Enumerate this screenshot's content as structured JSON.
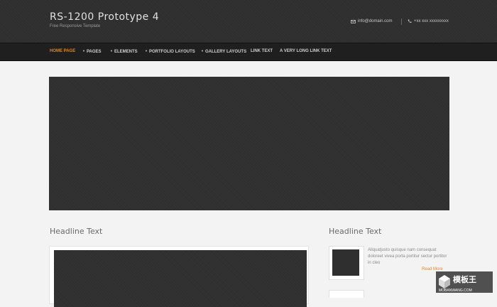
{
  "header": {
    "title": "RS-1200 Prototype 4",
    "tagline": "Free Responsive Template",
    "email": "info@domain.com",
    "phone": "+xx xxx xxxxxxxxx"
  },
  "nav": {
    "items": [
      {
        "label": "HOME PAGE",
        "active": true,
        "has_dropdown": false
      },
      {
        "label": "PAGES",
        "active": false,
        "has_dropdown": true
      },
      {
        "label": "ELEMENTS",
        "active": false,
        "has_dropdown": true
      },
      {
        "label": "PORTFOLIO LAYOUTS",
        "active": false,
        "has_dropdown": true
      },
      {
        "label": "GALLERY LAYOUTS",
        "active": false,
        "has_dropdown": true
      },
      {
        "label": "LINK TEXT",
        "active": false,
        "has_dropdown": false
      },
      {
        "label": "A VERY LONG LINK TEXT",
        "active": false,
        "has_dropdown": false
      }
    ]
  },
  "content": {
    "left_headline": "Headline Text",
    "right_headline": "Headline Text",
    "side_text": "Aliquatjusto quisque nam consequat doloreet vivea porta portitur sectur portitor in cleo",
    "read_more": "Read More"
  },
  "watermark": {
    "brand": "模板王",
    "url": "MOBANWANG.COM"
  },
  "colors": {
    "accent": "#e08a1e",
    "header_bg": "#2e2e2e",
    "nav_bg": "#1f1f1f",
    "page_bg": "#f3f3f3"
  }
}
